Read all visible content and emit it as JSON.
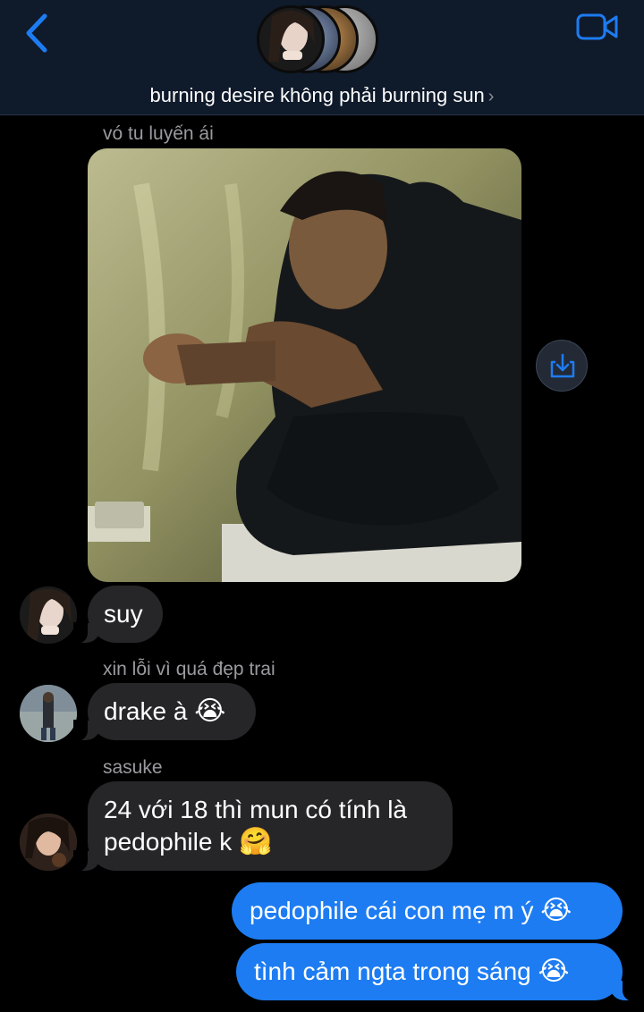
{
  "header": {
    "group_name": "burning desire không phải burning sun",
    "chevron": "›",
    "back_icon": "chevron-left-icon",
    "video_icon": "video-camera-icon",
    "accent": "#1d7cf2"
  },
  "messages": [
    {
      "type": "image",
      "sender": "vó tu luyến ái",
      "description_icon": "photo"
    },
    {
      "type": "text",
      "direction": "in",
      "text": "suy"
    },
    {
      "type": "text",
      "direction": "in",
      "sender": "xin lỗi vì quá đẹp trai",
      "text": "drake à",
      "emoji": "😭"
    },
    {
      "type": "text",
      "direction": "in",
      "sender": "sasuke",
      "line1": "24 với 18 thì mun có tính là",
      "line2": "pedophile k",
      "emoji": "🤗"
    },
    {
      "type": "text",
      "direction": "out",
      "text": "pedophile cái con mẹ m ý",
      "emoji": "😭"
    },
    {
      "type": "text",
      "direction": "out",
      "text": "tình cảm ngta trong sáng",
      "emoji": "😭"
    }
  ],
  "colors": {
    "incoming_bubble": "#262628",
    "outgoing_bubble": "#1d7cf2",
    "header_bg": "#0f1a2b"
  }
}
